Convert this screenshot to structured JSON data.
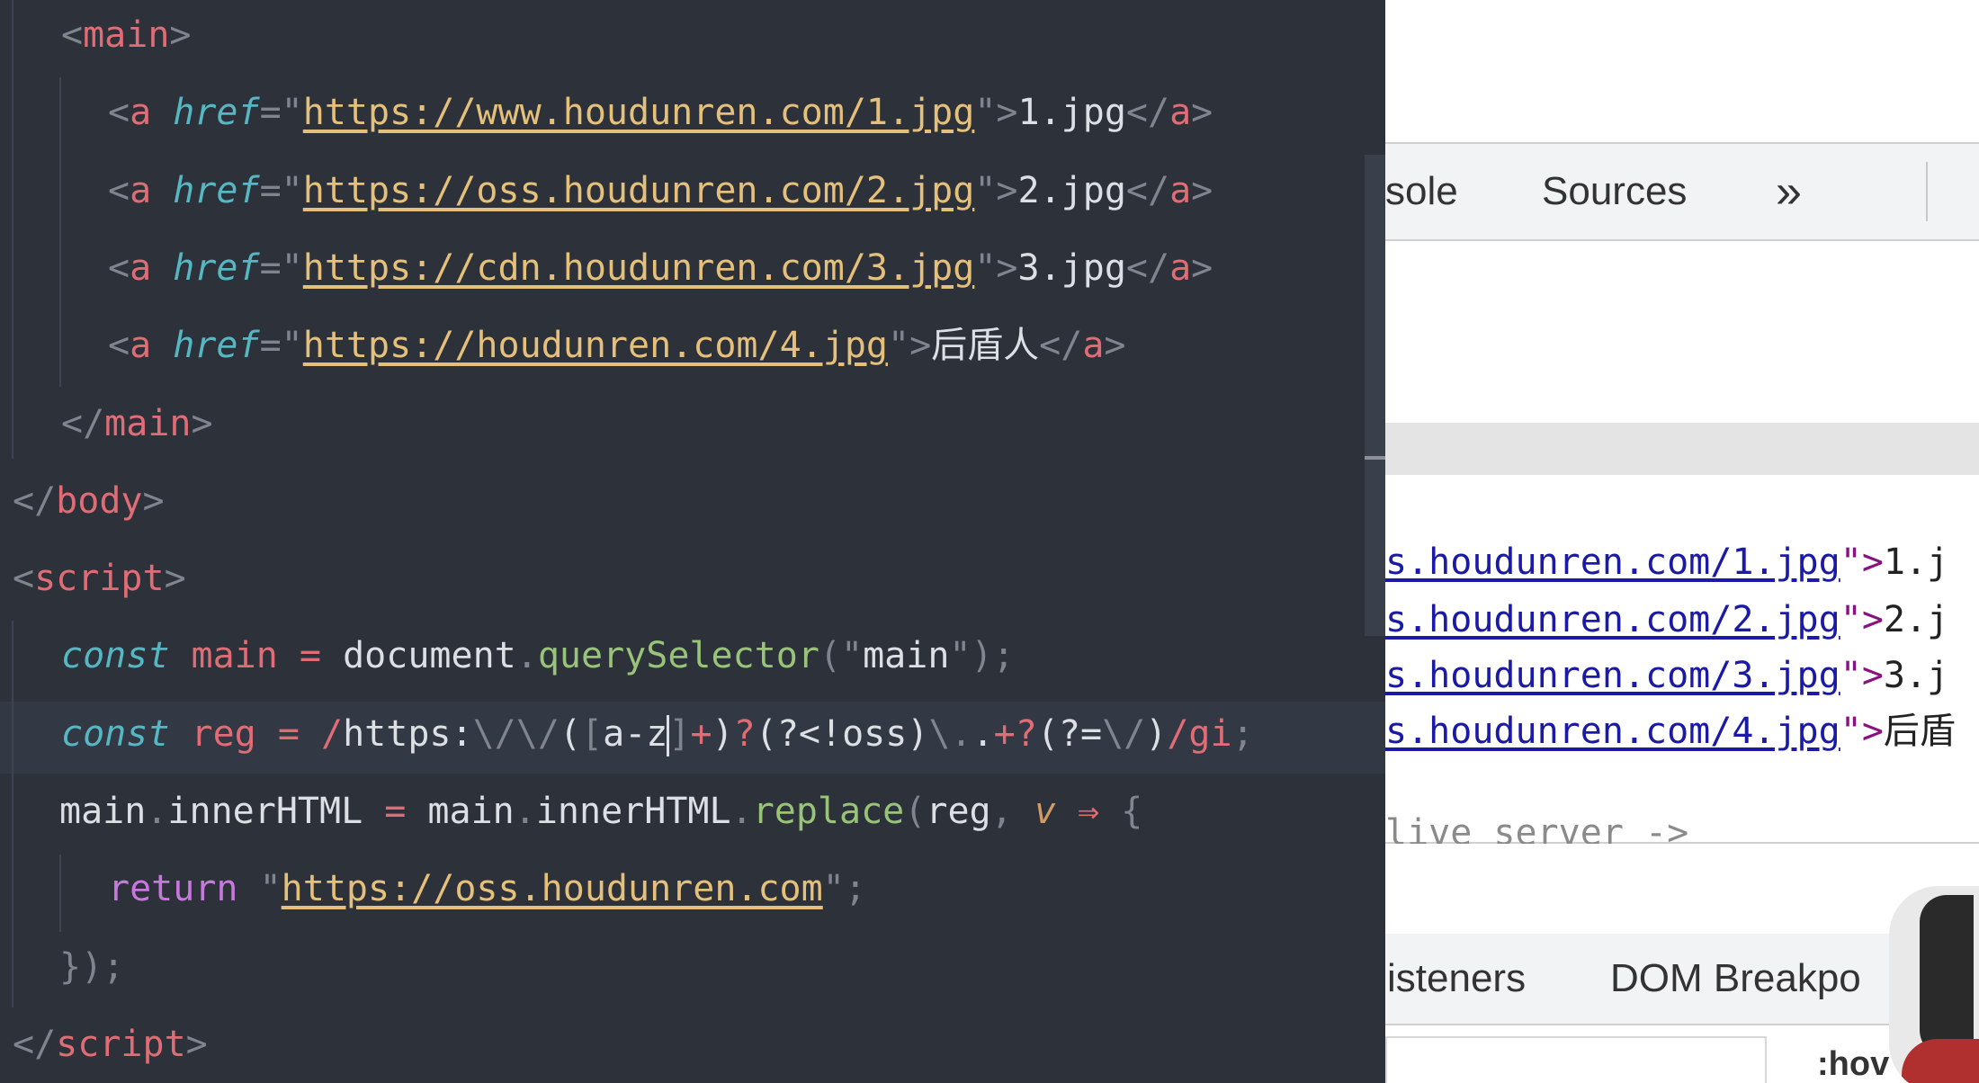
{
  "editor": {
    "lines": [
      {
        "parts": [
          {
            "c": "p",
            "t": "<"
          },
          {
            "c": "t",
            "t": "main"
          },
          {
            "c": "p",
            "t": ">"
          }
        ]
      },
      {
        "parts": [
          {
            "c": "p",
            "t": "<"
          },
          {
            "c": "t",
            "t": "a "
          },
          {
            "c": "at",
            "t": "href"
          },
          {
            "c": "p",
            "t": "=\""
          },
          {
            "c": "url",
            "t": "https://www.houdunren.com/1.jpg"
          },
          {
            "c": "p",
            "t": "\">"
          },
          {
            "c": "rd",
            "t": "1.jpg"
          },
          {
            "c": "p",
            "t": "</"
          },
          {
            "c": "t",
            "t": "a"
          },
          {
            "c": "p",
            "t": ">"
          }
        ]
      },
      {
        "parts": [
          {
            "c": "p",
            "t": "<"
          },
          {
            "c": "t",
            "t": "a "
          },
          {
            "c": "at",
            "t": "href"
          },
          {
            "c": "p",
            "t": "=\""
          },
          {
            "c": "url",
            "t": "https://oss.houdunren.com/2.jpg"
          },
          {
            "c": "p",
            "t": "\">"
          },
          {
            "c": "rd",
            "t": "2.jpg"
          },
          {
            "c": "p",
            "t": "</"
          },
          {
            "c": "t",
            "t": "a"
          },
          {
            "c": "p",
            "t": ">"
          }
        ]
      },
      {
        "parts": [
          {
            "c": "p",
            "t": "<"
          },
          {
            "c": "t",
            "t": "a "
          },
          {
            "c": "at",
            "t": "href"
          },
          {
            "c": "p",
            "t": "=\""
          },
          {
            "c": "url",
            "t": "https://cdn.houdunren.com/3.jpg"
          },
          {
            "c": "p",
            "t": "\">"
          },
          {
            "c": "rd",
            "t": "3.jpg"
          },
          {
            "c": "p",
            "t": "</"
          },
          {
            "c": "t",
            "t": "a"
          },
          {
            "c": "p",
            "t": ">"
          }
        ]
      },
      {
        "parts": [
          {
            "c": "p",
            "t": "<"
          },
          {
            "c": "t",
            "t": "a "
          },
          {
            "c": "at",
            "t": "href"
          },
          {
            "c": "p",
            "t": "=\""
          },
          {
            "c": "url",
            "t": "https://houdunren.com/4.jpg"
          },
          {
            "c": "p",
            "t": "\">"
          },
          {
            "c": "rd",
            "t": "后盾人"
          },
          {
            "c": "p",
            "t": "</"
          },
          {
            "c": "t",
            "t": "a"
          },
          {
            "c": "p",
            "t": ">"
          }
        ]
      },
      {
        "parts": [
          {
            "c": "p",
            "t": "</"
          },
          {
            "c": "t",
            "t": "main"
          },
          {
            "c": "p",
            "t": ">"
          }
        ]
      },
      {
        "parts": [
          {
            "c": "p",
            "t": "</"
          },
          {
            "c": "t",
            "t": "body"
          },
          {
            "c": "p",
            "t": ">"
          }
        ]
      },
      {
        "parts": [
          {
            "c": "p",
            "t": "<"
          },
          {
            "c": "t",
            "t": "script"
          },
          {
            "c": "p",
            "t": ">"
          }
        ]
      },
      {
        "parts": [
          {
            "c": "kw",
            "t": "const "
          },
          {
            "c": "vr",
            "t": "main "
          },
          {
            "c": "op",
            "t": "= "
          },
          {
            "c": "rd",
            "t": "document"
          },
          {
            "c": "p",
            "t": "."
          },
          {
            "c": "fn",
            "t": "querySelector"
          },
          {
            "c": "p",
            "t": "(\""
          },
          {
            "c": "rd",
            "t": "main"
          },
          {
            "c": "p",
            "t": "\");"
          }
        ]
      },
      {
        "parts": [
          {
            "c": "kw",
            "t": "const "
          },
          {
            "c": "vr",
            "t": "reg "
          },
          {
            "c": "op",
            "t": "= "
          },
          {
            "c": "rx",
            "t": "/"
          },
          {
            "c": "rd",
            "t": "https:"
          },
          {
            "c": "p",
            "t": "\\/\\/"
          },
          {
            "c": "rd",
            "t": "("
          },
          {
            "c": "p",
            "t": "["
          },
          {
            "c": "rd",
            "t": "a-z"
          },
          {
            "c": "caret",
            "t": ""
          },
          {
            "c": "p",
            "t": "]"
          },
          {
            "c": "rx",
            "t": "+"
          },
          {
            "c": "rd",
            "t": ")"
          },
          {
            "c": "rx",
            "t": "?"
          },
          {
            "c": "rd",
            "t": "(?<!oss)"
          },
          {
            "c": "p",
            "t": "\\."
          },
          {
            "c": "rd",
            "t": "."
          },
          {
            "c": "rx",
            "t": "+?"
          },
          {
            "c": "rd",
            "t": "(?="
          },
          {
            "c": "p",
            "t": "\\/"
          },
          {
            "c": "rd",
            "t": ")"
          },
          {
            "c": "rx",
            "t": "/gi"
          },
          {
            "c": "p",
            "t": ";"
          }
        ]
      },
      {
        "parts": [
          {
            "c": "rd",
            "t": "main"
          },
          {
            "c": "p",
            "t": "."
          },
          {
            "c": "rd",
            "t": "innerHTML "
          },
          {
            "c": "op",
            "t": "= "
          },
          {
            "c": "rd",
            "t": "main"
          },
          {
            "c": "p",
            "t": "."
          },
          {
            "c": "rd",
            "t": "innerHTML"
          },
          {
            "c": "p",
            "t": "."
          },
          {
            "c": "fn",
            "t": "replace"
          },
          {
            "c": "p",
            "t": "("
          },
          {
            "c": "rd",
            "t": "reg"
          },
          {
            "c": "p",
            "t": ", "
          },
          {
            "c": "pm",
            "t": "v "
          },
          {
            "c": "op",
            "t": "⇒ "
          },
          {
            "c": "p",
            "t": "{"
          }
        ]
      },
      {
        "parts": [
          {
            "c": "rk",
            "t": "return "
          },
          {
            "c": "p",
            "t": "\""
          },
          {
            "c": "url",
            "t": "https://oss.houdunren.com"
          },
          {
            "c": "p",
            "t": "\";"
          }
        ]
      },
      {
        "parts": [
          {
            "c": "p",
            "t": "});"
          }
        ]
      },
      {
        "parts": [
          {
            "c": "p",
            "t": "</"
          },
          {
            "c": "t",
            "t": "script"
          },
          {
            "c": "p",
            "t": ">"
          }
        ]
      }
    ]
  },
  "devtools": {
    "tabs": {
      "console": "sole",
      "sources": "Sources",
      "more": "»"
    },
    "dom_rows": [
      {
        "link": "s.houdunren.com/1.jpg",
        "text": "1.j"
      },
      {
        "link": "s.houdunren.com/2.jpg",
        "text": "2.j"
      },
      {
        "link": "s.houdunren.com/3.jpg",
        "text": "3.j"
      },
      {
        "link": "s.houdunren.com/4.jpg",
        "text": "后盾"
      }
    ],
    "dom_cut": "live server ->",
    "subtabs": {
      "listeners": "isteners",
      "dom_breakpoints": "DOM Breakpo"
    },
    "hov": ":hov"
  }
}
